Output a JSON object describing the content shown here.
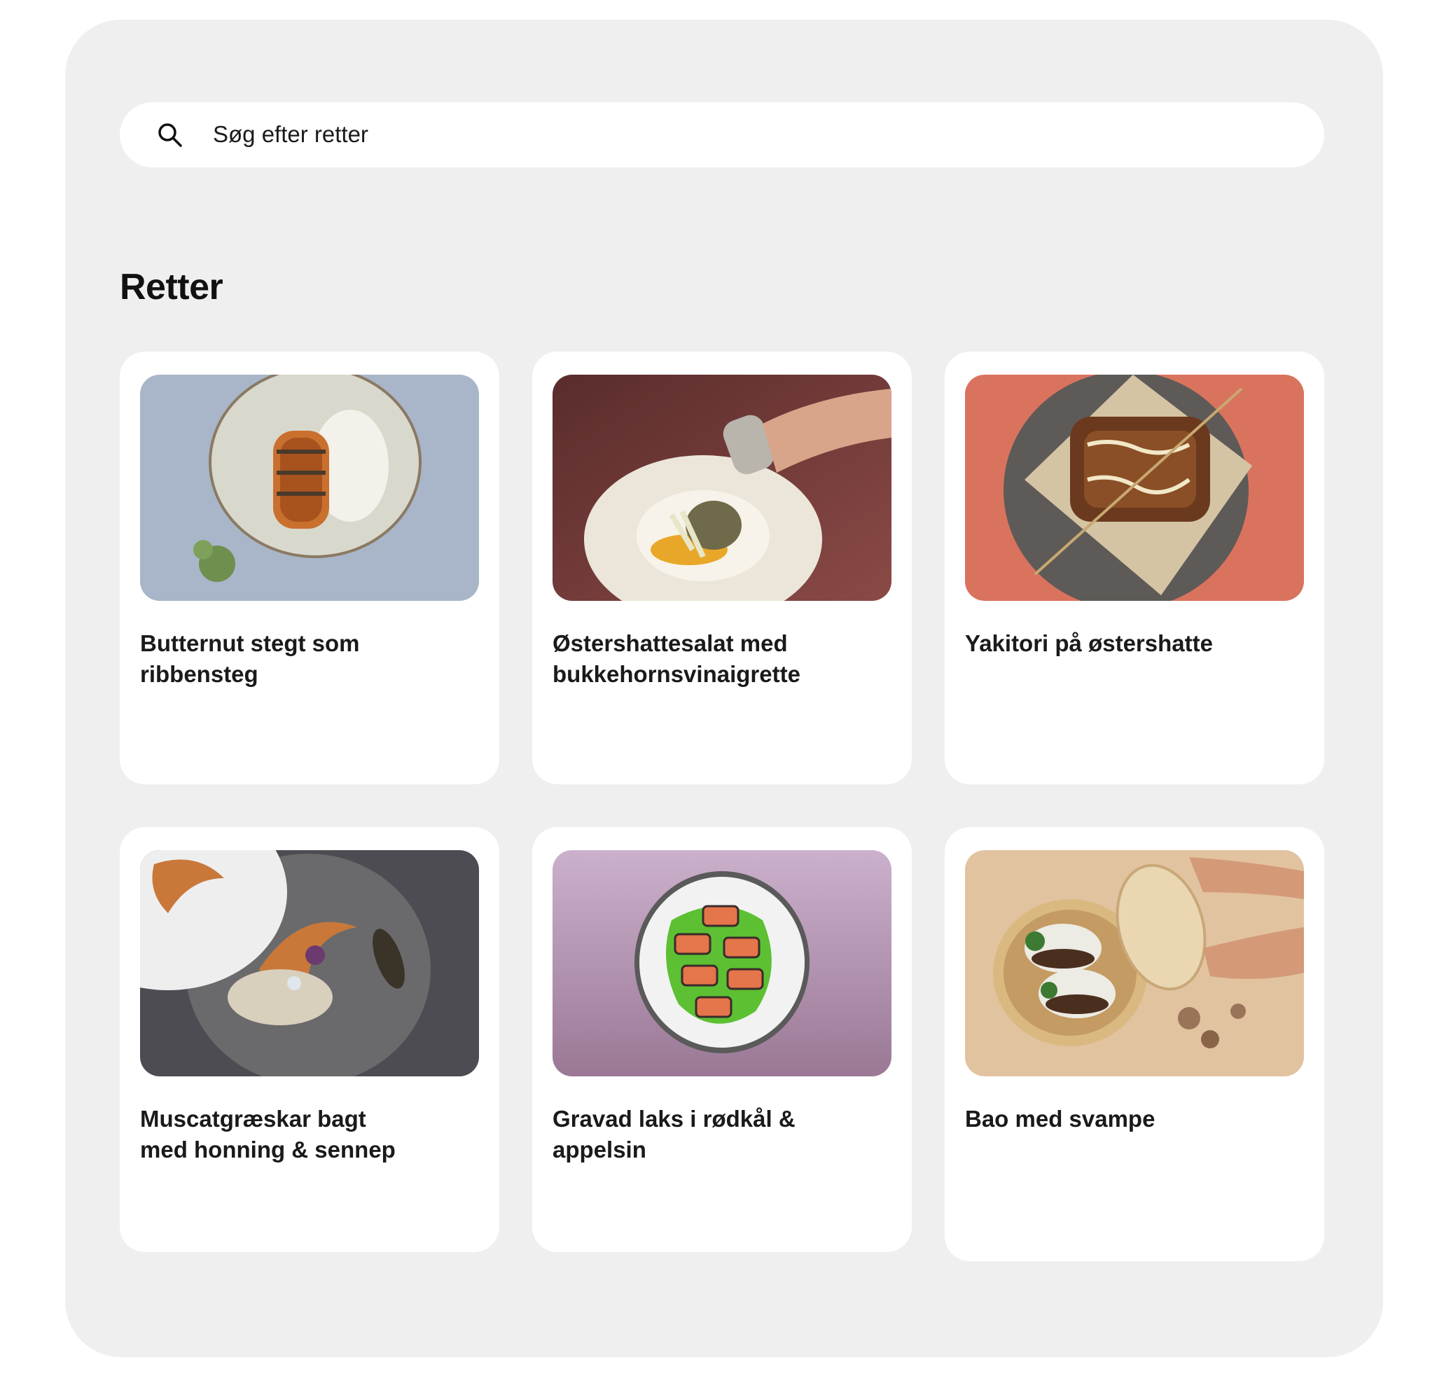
{
  "search": {
    "placeholder": "Søg efter retter",
    "icon": "search-icon"
  },
  "section": {
    "title": "Retter"
  },
  "dishes": [
    {
      "title": "Butternut stegt som\nribbensteg",
      "bg": "#a9b6c9"
    },
    {
      "title": "Østershattesalat med\nbukkehornsvinaigrette",
      "bg": "#6a3a38"
    },
    {
      "title": "Yakitori på østershatte",
      "bg": "#d9735e"
    },
    {
      "title": "Muscatgræskar bagt\nmed honning & sennep",
      "bg": "#4c4c52"
    },
    {
      "title": "Gravad laks i rødkål &\nappelsin",
      "bg": "#b08fae"
    },
    {
      "title": "Bao med svampe",
      "bg": "#e2c3a0"
    }
  ],
  "colors": {
    "panel": "#efefef",
    "card": "#ffffff",
    "text": "#1a1a1a"
  }
}
